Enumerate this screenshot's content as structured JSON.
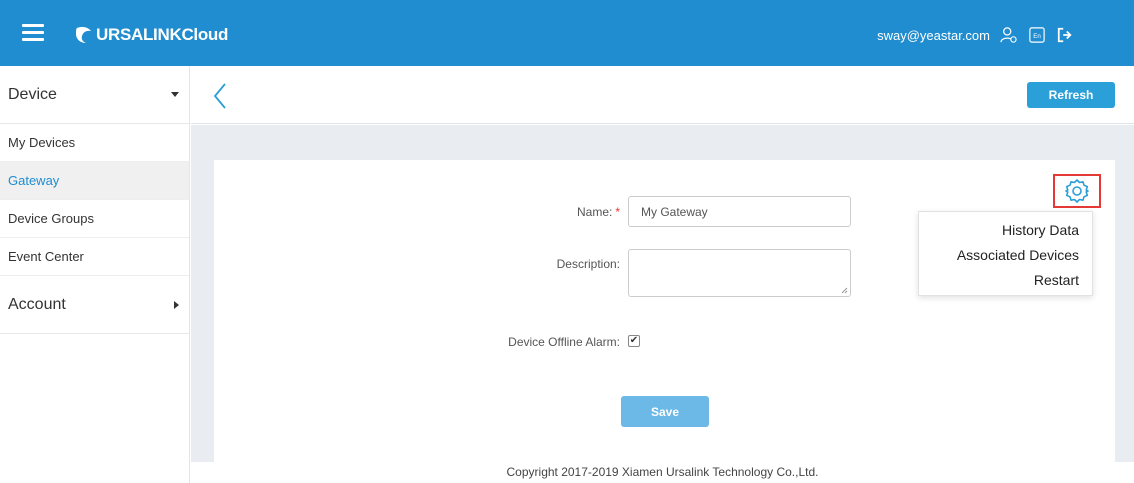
{
  "header": {
    "logo_text": "URSALINK",
    "logo_suffix": "Cloud",
    "user_email": "sway@yeastar.com",
    "icons": [
      "user-settings-icon",
      "language-icon",
      "logout-icon"
    ]
  },
  "sidebar": {
    "sections": [
      {
        "label": "Device",
        "expanded": true,
        "items": [
          {
            "label": "My Devices",
            "active": false
          },
          {
            "label": "Gateway",
            "active": true
          },
          {
            "label": "Device Groups",
            "active": false
          },
          {
            "label": "Event Center",
            "active": false
          }
        ]
      },
      {
        "label": "Account",
        "expanded": false,
        "items": []
      }
    ]
  },
  "toolbar": {
    "refresh_label": "Refresh"
  },
  "form": {
    "name_label": "Name:",
    "name_required": "*",
    "name_value": "My Gateway",
    "description_label": "Description:",
    "description_value": "",
    "offline_alarm_label": "Device Offline Alarm:",
    "offline_alarm_checked": "✔",
    "save_label": "Save"
  },
  "settings_menu": {
    "items": [
      "History Data",
      "Associated Devices",
      "Restart"
    ]
  },
  "footer": {
    "copyright": "Copyright 2017-2019 Xiamen Ursalink Technology Co.,Ltd."
  },
  "colors": {
    "header_bg": "#1f8dcf",
    "accent": "#2a9fd8",
    "highlight_border": "#e53935"
  }
}
